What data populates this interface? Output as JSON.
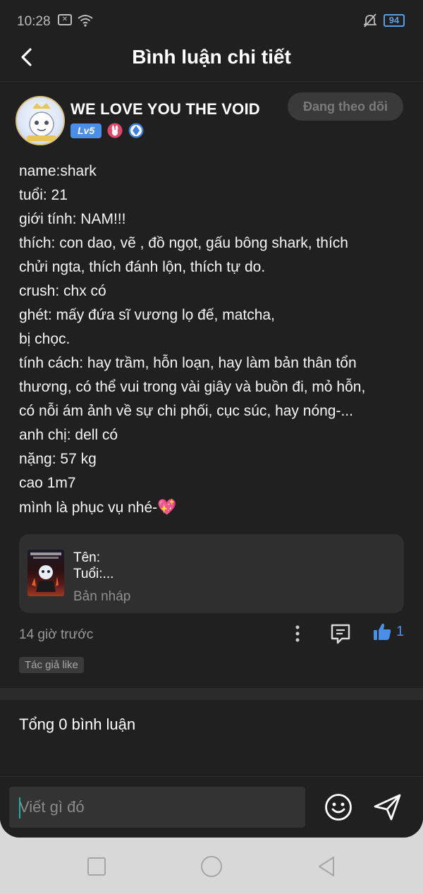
{
  "status_bar": {
    "time": "10:28",
    "battery": "94"
  },
  "header": {
    "title": "Bình luận chi tiết"
  },
  "author": {
    "name": "WE LOVE YOU THE VOID",
    "level": "Lv5",
    "follow_label": "Đang theo dõi"
  },
  "post": {
    "lines": [
      "name:shark",
      "tuổi: 21",
      "giới tính: NAM!!!",
      "thích: con dao, vẽ , đồ ngọt, gấu bông shark, thích",
      "chửi ngta, thích đánh lộn, thích tự do.",
      "crush: chx có",
      "ghét: mấy đứa sĩ vương lọ đế, matcha,",
      "bị chọc.",
      "tính cách: hay trầm, hỗn loạn, hay làm bản thân tổn",
      "thương, có thể vui trong vài giây và buồn đi, mỏ hỗn,",
      "có nỗi ám ảnh về sự chi phối, cục súc, hay nóng-...",
      "anh chị: dell có",
      "nặng: 57 kg",
      "cao 1m7"
    ],
    "last_line": "mình là phục vụ nhé-",
    "last_line_emoji": "💖"
  },
  "draft": {
    "line1": "Tên:",
    "line2": "Tuổi:...",
    "status": "Bản nháp"
  },
  "meta": {
    "time_ago": "14 giờ trước",
    "like_count": "1",
    "author_like_tag": "Tác giả like"
  },
  "comments": {
    "total_label": "Tổng 0 bình luận"
  },
  "input": {
    "placeholder": "Viết gì đó"
  },
  "colors": {
    "accent": "#4a8fe7",
    "background": "#202020",
    "cursor": "#19b39b"
  }
}
